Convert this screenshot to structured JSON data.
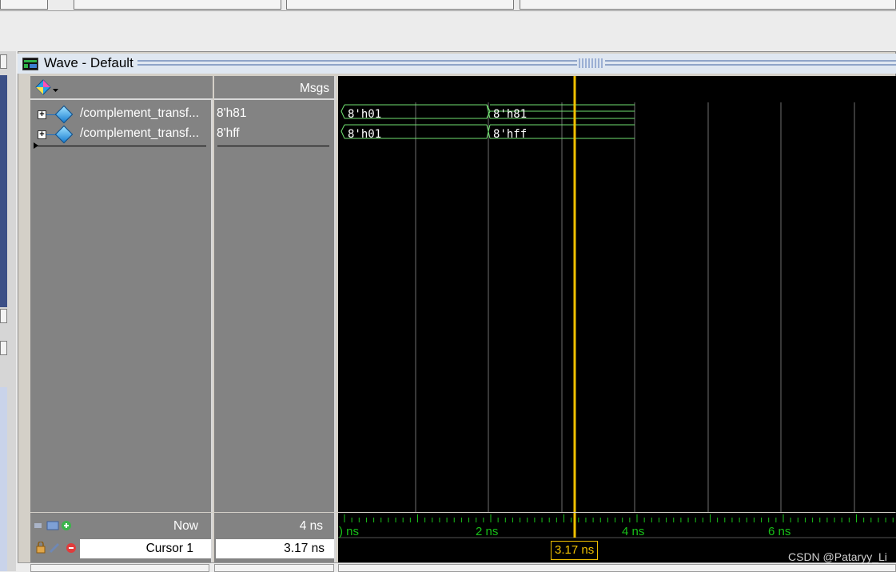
{
  "window": {
    "title": "Wave - Default"
  },
  "columns": {
    "msgs_header": "Msgs"
  },
  "signals": [
    {
      "name": "/complement_transf...",
      "value": "8'h81",
      "segments": [
        "8'h01",
        "8'h81"
      ]
    },
    {
      "name": "/complement_transf...",
      "value": "8'hff",
      "segments": [
        "8'h01",
        "8'hff"
      ]
    }
  ],
  "status": {
    "now_label": "Now",
    "now_value": "4 ns",
    "cursor_label": "Cursor 1",
    "cursor_value": "3.17 ns"
  },
  "timeline": {
    "tick_labels": [
      ") ns",
      "2 ns",
      "4 ns",
      "6 ns"
    ],
    "cursor_tag": "3.17 ns"
  },
  "colors": {
    "wave": "#70e070",
    "cursor": "#f0c000",
    "grid": "#707070",
    "timeline_text": "#18c018"
  },
  "watermark": "CSDN @Pataryy_Li"
}
